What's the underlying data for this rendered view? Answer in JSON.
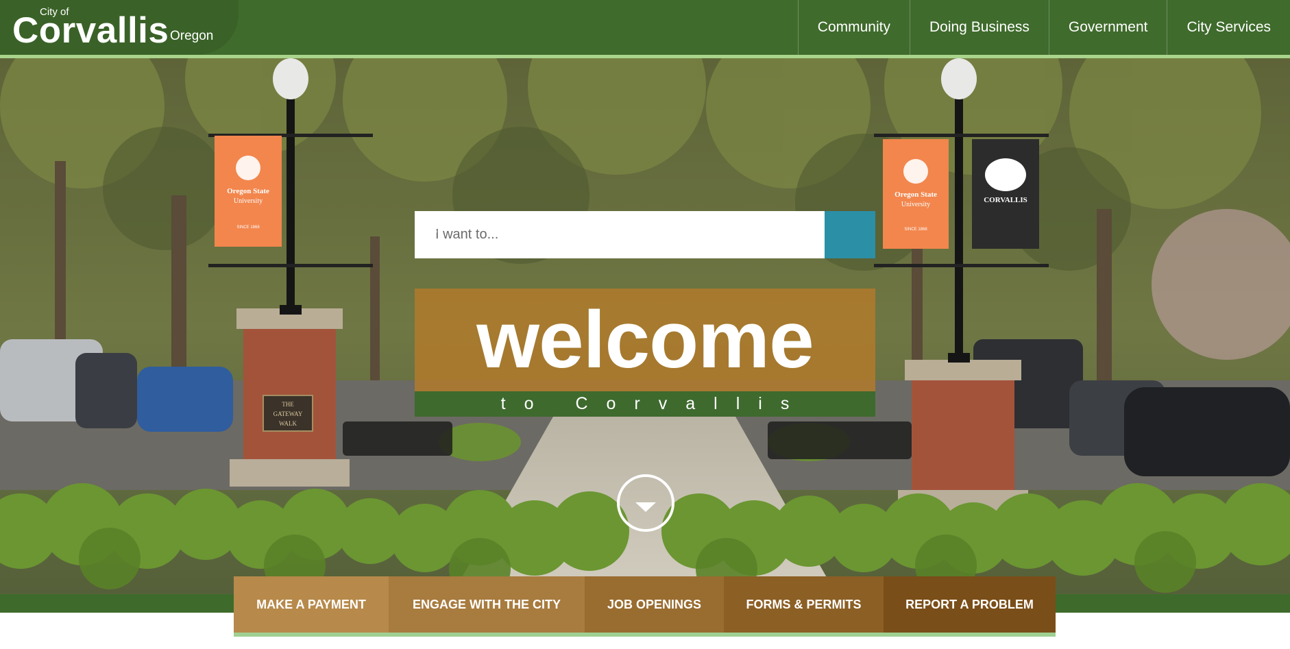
{
  "header": {
    "logo": {
      "city_of": "City of",
      "name": "Corvallis",
      "state": "Oregon"
    },
    "nav": [
      "Community",
      "Doing Business",
      "Government",
      "City Services"
    ]
  },
  "hero": {
    "search": {
      "placeholder": "I want to..."
    },
    "banners": {
      "osu_name": "Oregon State",
      "osu_sub": "University",
      "osu_since": "SINCE 1868",
      "corvallis": "CORVALLIS"
    },
    "plaque": {
      "line1": "THE",
      "line2": "GATEWAY",
      "line3": "WALK"
    },
    "welcome": {
      "title": "welcome",
      "subtitle": "to Corvallis"
    }
  },
  "quick_links": [
    {
      "label": "MAKE A PAYMENT",
      "color": "#b7894a"
    },
    {
      "label": "ENGAGE WITH THE CITY",
      "color": "#a87b3f"
    },
    {
      "label": "JOB OPENINGS",
      "color": "#996c30"
    },
    {
      "label": "FORMS & PERMITS",
      "color": "#8c5f25"
    },
    {
      "label": "REPORT A PROBLEM",
      "color": "#7a4e18"
    }
  ],
  "colors": {
    "header": "#3f6b2c",
    "accent_line": "#a9d48b",
    "search_button": "#2b8fa6",
    "welcome_bg": "#b07a2c",
    "welcome_sub_bg": "#3e6a2e"
  }
}
